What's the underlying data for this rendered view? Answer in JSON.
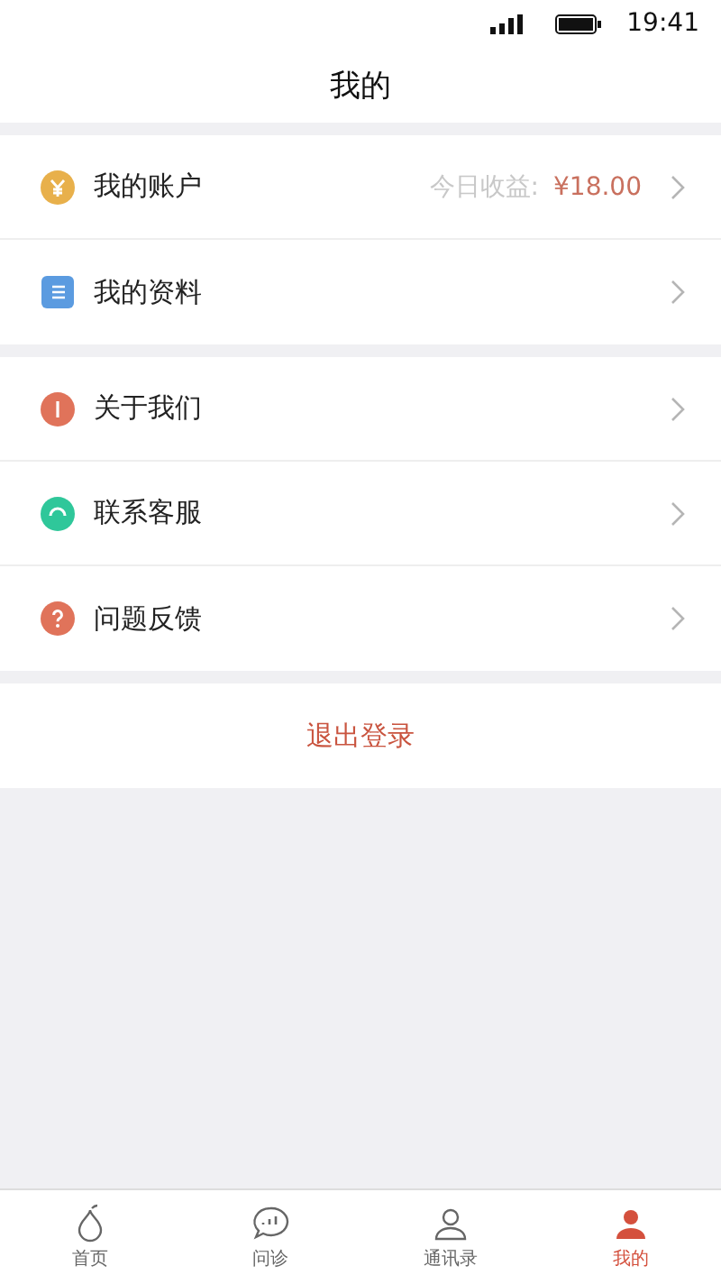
{
  "status_bar": {
    "time": "19:41"
  },
  "title": "我的",
  "menu_groups": [
    {
      "items": [
        {
          "label": "我的账户",
          "color": "#e8b04b",
          "detail_label": "今日收益:",
          "detail_value": "¥18.00"
        },
        {
          "label": "我的资料",
          "color": "#5b9be0"
        }
      ]
    },
    {
      "items": [
        {
          "label": "关于我们",
          "color": "#e0735a"
        },
        {
          "label": "联系客服",
          "color": "#2fc79a"
        },
        {
          "label": "问题反馈",
          "color": "#e0735a"
        }
      ]
    }
  ],
  "logout": "退出登录",
  "tabs": [
    {
      "label": "首页",
      "selected": false
    },
    {
      "label": "问诊",
      "selected": false
    },
    {
      "label": "通讯录",
      "selected": false
    },
    {
      "label": "我的",
      "selected": true
    }
  ]
}
